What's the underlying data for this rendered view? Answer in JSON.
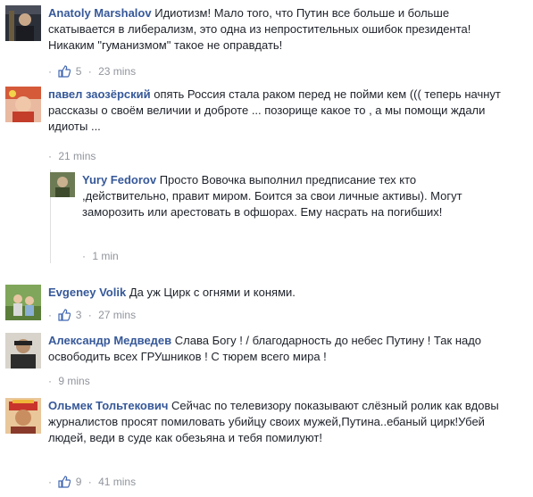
{
  "comments": [
    {
      "author": "Anatoly Marshalov",
      "text": "Идиотизм! Мало того, что Путин все больше и больше скатывается в либерализм, это одна из непростительных ошибок президента! Никаким \"гуманизмом\" такое не оправдать!",
      "likes": "5",
      "time": "23 mins"
    },
    {
      "author": "павел заозёрский",
      "text": "опять Россия стала раком перед не пойми кем ((( теперь начнут рассказы о своём величии и доброте ... позорище какое то , а мы помощи ждали идиоты ...",
      "likes": "",
      "time": "21 mins"
    },
    {
      "author": "Yury Fedorov",
      "text": "Просто Вовочка выполнил предписание тех кто ,действительно, правит миром. Боится за свои личные активы). Могут заморозить или арестовать в офшорах. Ему насрать на погибших!",
      "likes": "",
      "time": "1 min"
    },
    {
      "author": "Evgeney Volik",
      "text": "Да уж Цирк с огнями и конями.",
      "likes": "3",
      "time": "27 mins"
    },
    {
      "author": "Александр Медведев",
      "text": "Слава Богу ! / благодарность до небес Путину ! Так надо освободить всех ГРУшников ! С тюрем всего мира !",
      "likes": "",
      "time": "9 mins"
    },
    {
      "author": "Ольмек Тольтекович",
      "text": "Сейчас по телевизору показывают слёзный ролик как вдовы журналистов просят помиловать убийцу своих мужей,Путина..ебаный цирк!Убей людей, веди в суде как обезьяна и тебя помилуют!",
      "likes": "9",
      "time": "41 mins"
    }
  ],
  "separator": "·",
  "colors": {
    "author": "#365899",
    "text": "#1d2129",
    "meta": "#90949c",
    "like": "#4267b2"
  },
  "icons": {
    "like": "thumbs-up-icon"
  }
}
